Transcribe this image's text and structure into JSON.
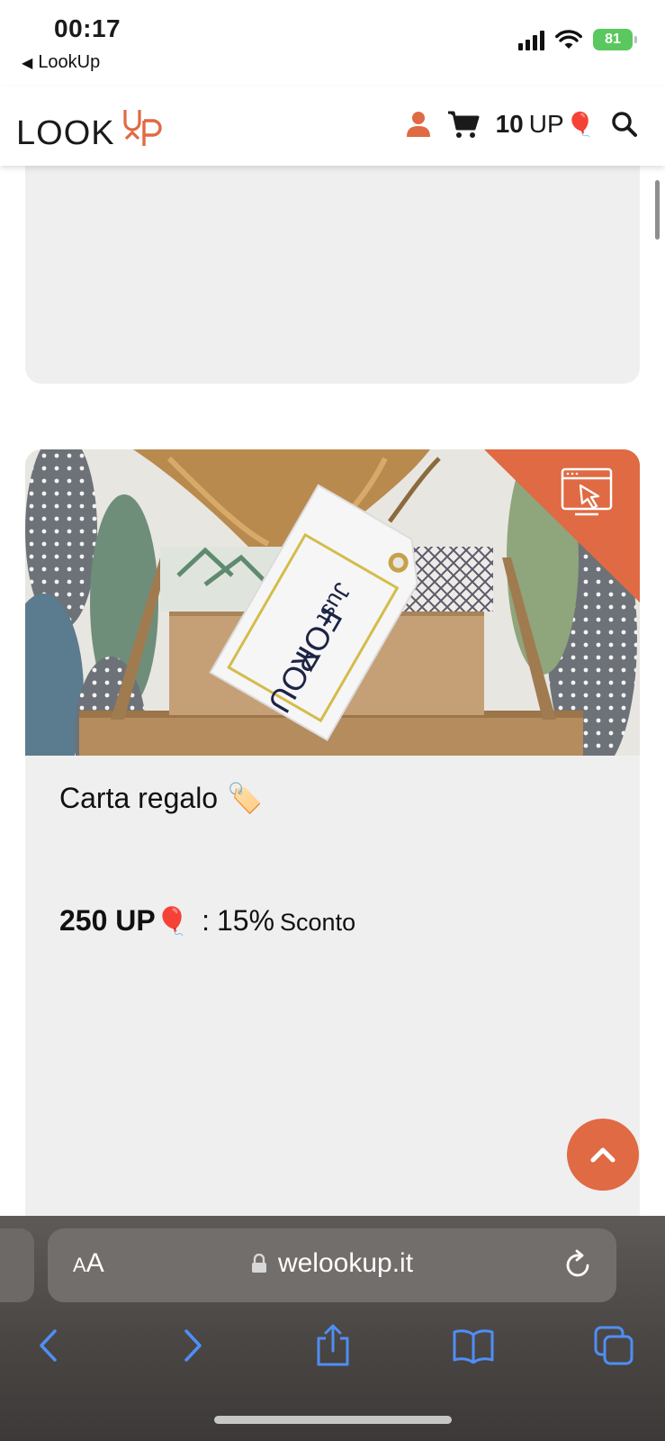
{
  "status_bar": {
    "time": "00:17",
    "back_app": "LookUp",
    "battery": "81"
  },
  "header": {
    "logo_text": "LOOKUP",
    "points_value": "10",
    "points_unit": "UP",
    "balloon": "🎈",
    "icons": [
      "user-icon",
      "cart-icon",
      "balloon-icon",
      "search-icon"
    ],
    "accent_color": "#e06a43"
  },
  "card": {
    "image_tag_text": [
      "Just",
      "FOR",
      "YOU"
    ],
    "title": "Carta regalo",
    "title_emoji": "🏷️",
    "price_amount": "250 UP",
    "price_balloon": "🎈",
    "price_separator": ":",
    "discount_percent": "15%",
    "discount_label": "Sconto"
  },
  "browser": {
    "aa_small": "A",
    "aa_large": "A",
    "url": "welookup.it",
    "toolbar_icons": [
      "back-icon",
      "forward-icon",
      "share-icon",
      "bookmarks-icon",
      "tabs-icon"
    ]
  }
}
